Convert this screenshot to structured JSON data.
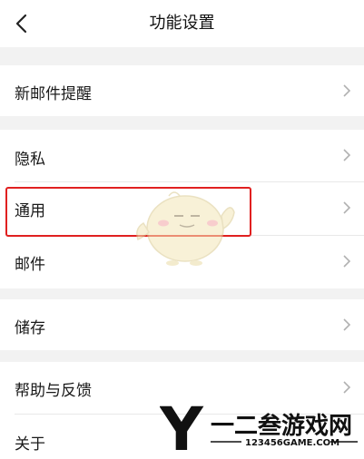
{
  "header": {
    "title": "功能设置",
    "back_icon": "chevron-left-icon"
  },
  "groups": [
    {
      "items": [
        {
          "label": "新邮件提醒"
        }
      ]
    },
    {
      "items": [
        {
          "label": "隐私"
        },
        {
          "label": "通用",
          "highlighted": true
        },
        {
          "label": "邮件"
        }
      ]
    },
    {
      "items": [
        {
          "label": "储存"
        }
      ]
    },
    {
      "items": [
        {
          "label": "帮助与反馈"
        },
        {
          "label": "关于"
        }
      ]
    }
  ],
  "chevron_icon": "chevron-right-icon",
  "colors": {
    "background": "#f2f2f2",
    "row": "#ffffff",
    "highlight_border": "#e02020",
    "chevron": "#b0b0b0"
  },
  "watermark": {
    "logo_letter": "Y",
    "name": "一二叁游戏网",
    "url": "123456GAME.COM"
  }
}
